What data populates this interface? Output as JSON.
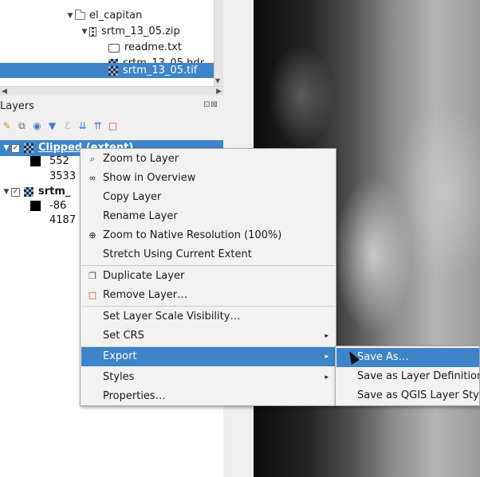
{
  "browser": {
    "items": [
      {
        "label": "el_capitan"
      },
      {
        "label": "srtm_13_05.zip"
      },
      {
        "label": "readme.txt"
      },
      {
        "label": "srtm_13_05.hdr"
      },
      {
        "label": "srtm_13_05.tif"
      }
    ]
  },
  "layers_panel": {
    "title": "Layers",
    "dock_buttons": "⊡⊠",
    "layers": [
      {
        "name": "Clipped (extent)",
        "checked": "✓",
        "legend": [
          "552",
          "3533"
        ]
      },
      {
        "name": "srtm_",
        "checked": "✓",
        "legend": [
          "-86",
          "4187"
        ]
      }
    ]
  },
  "context_menu": {
    "items": [
      {
        "label": "Zoom to Layer",
        "icon": "magnifier-icon"
      },
      {
        "label": "Show in Overview",
        "icon": "glasses-icon"
      },
      {
        "label": "Copy Layer"
      },
      {
        "label": "Rename Layer"
      },
      {
        "label": "Zoom to Native Resolution (100%)",
        "icon": "zoom-native-icon"
      },
      {
        "label": "Stretch Using Current Extent"
      },
      {
        "label": "Duplicate Layer",
        "icon": "duplicate-icon"
      },
      {
        "label": "Remove Layer…",
        "icon": "remove-icon"
      },
      {
        "label": "Set Layer Scale Visibility…"
      },
      {
        "label": "Set CRS",
        "submenu_arrow": "▸"
      },
      {
        "label": "Export",
        "submenu_arrow": "▸"
      },
      {
        "label": "Styles",
        "submenu_arrow": "▸"
      },
      {
        "label": "Properties…"
      }
    ]
  },
  "export_submenu": {
    "items": [
      {
        "label": "Save As…"
      },
      {
        "label": "Save as Layer Definition"
      },
      {
        "label": "Save as QGIS Layer Style"
      }
    ]
  },
  "colors": {
    "selection": "#3e84c8",
    "menu_bg": "#f2f2f2"
  }
}
